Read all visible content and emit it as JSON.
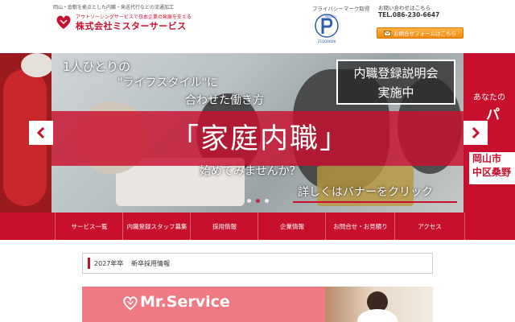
{
  "header": {
    "tagline": "岡山・倉敷を拠点とした内職・発送代行などの流通加工",
    "logo_sub": "アウトソーシングサービスで日本企業の発展を支える",
    "logo_name": "株式会社ミスターサービス",
    "privacy_label": "プライバシーマーク取得",
    "privacy_mark_text": "PRIVACY",
    "privacy_number": "21000606",
    "contact_label": "お問い合わせはこちら",
    "tel": "TEL.086-230-6647",
    "contact_button": "お問合せフォームはこちら"
  },
  "slider": {
    "headline_1": "1人ひとりの",
    "headline_2": "\"ライフスタイル\"に",
    "headline_3": "合わせた働き方",
    "badge_line_1": "内職登録説明会",
    "badge_line_2": "実施中",
    "main_title": "「家庭内職」",
    "sub_line": "始めてみませんか？",
    "cta": "詳しくはバナーをクリック",
    "peek_text_1": "あなたの",
    "peek_text_2": "パ",
    "peek_box_1": "岡山市",
    "peek_box_2": "中区桑野",
    "active_dot": 2,
    "dot_count": 3
  },
  "nav": {
    "items": [
      "サービス一覧",
      "内職登録スタッフ募集",
      "採用情報",
      "企業情報",
      "お問合せ・お見積り",
      "アクセス"
    ]
  },
  "notice": {
    "date": "2027年卒",
    "title": "新卒採用情報"
  },
  "recruit_banner": {
    "logo_text": "Mr.Service"
  },
  "colors": {
    "brand_red": "#c8102e",
    "contact_orange": "#f08a10",
    "recruit_pink": "#f07a83"
  }
}
